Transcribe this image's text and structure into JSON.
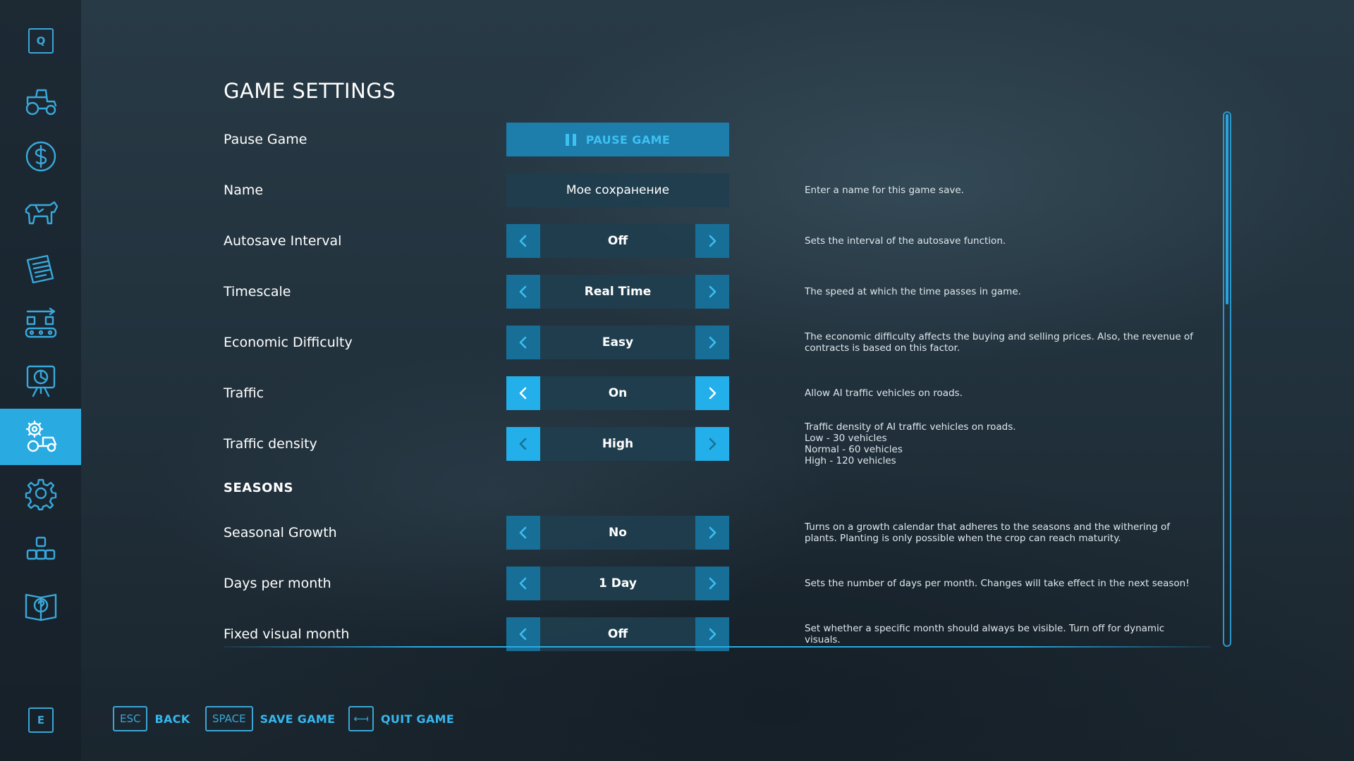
{
  "sidebar": {
    "top_key": "Q",
    "bottom_key": "E",
    "items": [
      {
        "icon": "tractor-icon"
      },
      {
        "icon": "dollar-icon"
      },
      {
        "icon": "cow-icon"
      },
      {
        "icon": "contracts-icon"
      },
      {
        "icon": "production-icon"
      },
      {
        "icon": "map-icon"
      },
      {
        "icon": "game-settings-icon",
        "active": true
      },
      {
        "icon": "gear-icon"
      },
      {
        "icon": "mods-icon"
      },
      {
        "icon": "help-book-icon"
      }
    ]
  },
  "page": {
    "title": "GAME SETTINGS",
    "seasons_header": "SEASONS"
  },
  "settings": {
    "pause": {
      "label": "Pause Game",
      "button": "PAUSE GAME"
    },
    "name": {
      "label": "Name",
      "value": "Мое сохранение",
      "desc": "Enter a name for this game save."
    },
    "autosave": {
      "label": "Autosave Interval",
      "value": "Off",
      "desc": "Sets the interval of the autosave function."
    },
    "timescale": {
      "label": "Timescale",
      "value": "Real Time",
      "desc": "The speed at which the time passes in game."
    },
    "economic": {
      "label": "Economic Difficulty",
      "value": "Easy",
      "desc_line1": "The economic difficulty affects the buying and selling prices. Also, the revenue of",
      "desc_line2": "contracts is based on this factor."
    },
    "traffic": {
      "label": "Traffic",
      "value": "On",
      "desc": "Allow AI traffic vehicles on roads."
    },
    "traffic_density": {
      "label": "Traffic density",
      "value": "High",
      "desc_line1": "Traffic density of AI traffic vehicles on roads.",
      "desc_line2": "Low - 30 vehicles",
      "desc_line3": "Normal - 60 vehicles",
      "desc_line4": "High - 120 vehicles"
    },
    "seasonal_growth": {
      "label": "Seasonal Growth",
      "value": "No",
      "desc_line1": "Turns on a growth calendar that adheres to the seasons and the withering of",
      "desc_line2": "plants. Planting is only possible when the crop can reach maturity."
    },
    "days_per_month": {
      "label": "Days per month",
      "value": "1 Day",
      "desc": "Sets the number of days per month. Changes will take effect in the next season!"
    },
    "fixed_visual_month": {
      "label": "Fixed visual month",
      "value": "Off",
      "desc": "Set whether a specific month should always be visible. Turn off for dynamic visuals."
    }
  },
  "footer": {
    "back": {
      "key": "ESC",
      "label": "BACK"
    },
    "save": {
      "key": "SPACE",
      "label": "SAVE GAME"
    },
    "quit": {
      "key": "⟻",
      "label": "QUIT GAME"
    }
  },
  "colors": {
    "accent": "#29abe2",
    "arrow_button": "#176f98",
    "value_box": "#203e4e"
  }
}
